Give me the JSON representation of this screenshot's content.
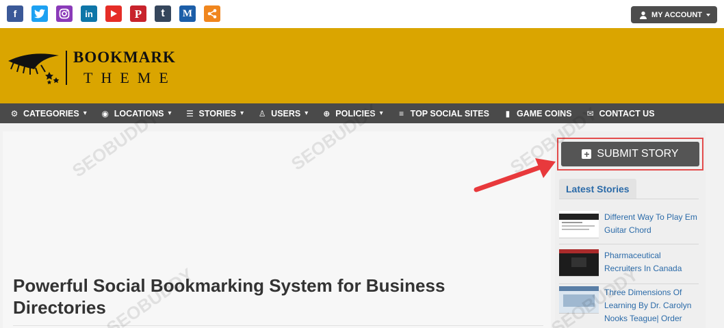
{
  "topbar": {
    "social_icons": [
      {
        "name": "facebook-icon",
        "glyph": "f",
        "color": "#3b5998"
      },
      {
        "name": "twitter-icon",
        "glyph": "t",
        "color": "#1da1f2"
      },
      {
        "name": "instagram-icon",
        "glyph": "◎",
        "color": "#8a3ab9"
      },
      {
        "name": "linkedin-icon",
        "glyph": "in",
        "color": "#0e76a8"
      },
      {
        "name": "youtube-icon",
        "glyph": "▶",
        "color": "#e52d27"
      },
      {
        "name": "pinterest-icon",
        "glyph": "P",
        "color": "#c8232c"
      },
      {
        "name": "tumblr-icon",
        "glyph": "t",
        "color": "#35465c"
      },
      {
        "name": "medium-icon",
        "glyph": "M",
        "color": "#1c5ea8"
      },
      {
        "name": "share-icon",
        "glyph": "<",
        "color": "#f0861e"
      }
    ],
    "account_label": "MY ACCOUNT"
  },
  "header": {
    "logo_line1": "BOOKMARK",
    "logo_line2": "THEME",
    "background": "#daa500"
  },
  "nav": {
    "items": [
      {
        "label": "CATEGORIES",
        "icon": "⚙",
        "dropdown": true
      },
      {
        "label": "LOCATIONS",
        "icon": "◉",
        "dropdown": true
      },
      {
        "label": "STORIES",
        "icon": "☰",
        "dropdown": true
      },
      {
        "label": "USERS",
        "icon": "♙",
        "dropdown": true
      },
      {
        "label": "POLICIES",
        "icon": "⊕",
        "dropdown": true
      },
      {
        "label": "TOP SOCIAL SITES",
        "icon": "≡",
        "dropdown": false
      },
      {
        "label": "GAME COINS",
        "icon": "▮",
        "dropdown": false
      },
      {
        "label": "CONTACT US",
        "icon": "✉",
        "dropdown": false
      }
    ]
  },
  "main": {
    "title": "Powerful Social Bookmarking System for Business Directories"
  },
  "sidebar": {
    "submit_label": "SUBMIT STORY",
    "latest_title": "Latest Stories",
    "stories": [
      {
        "title": "Different Way To Play Em Guitar Chord"
      },
      {
        "title": "Pharmaceutical Recruiters In Canada"
      },
      {
        "title": "Three Dimensions Of Learning By Dr. Carolyn Nooks Teague| Order"
      }
    ]
  }
}
